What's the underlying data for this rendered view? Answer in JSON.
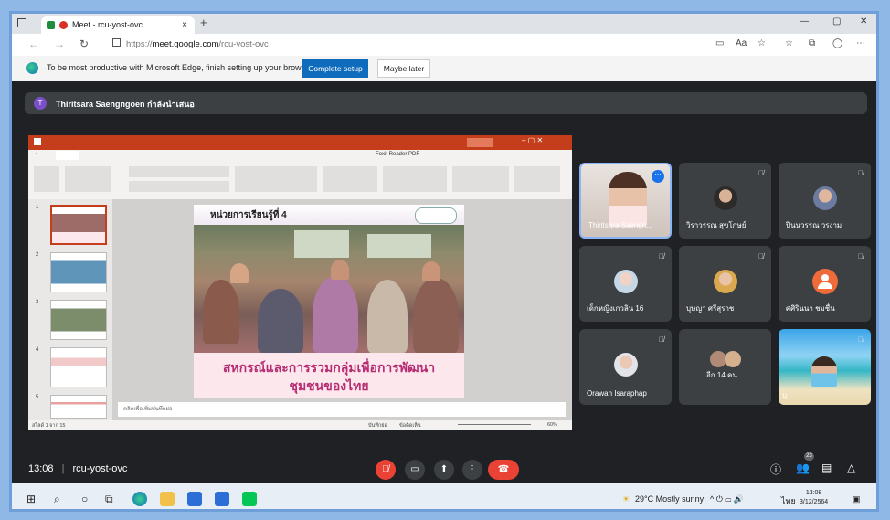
{
  "browser": {
    "tab_title": "Meet - rcu-yost-ovc",
    "tab_close": "×",
    "new_tab": "+",
    "url_prefix": "https://",
    "url_host": "meet.google.com",
    "url_path": "/rcu-yost-ovc",
    "minimize": "—",
    "restore": "▢",
    "close": "✕"
  },
  "infobar": {
    "message": "To be most productive with Microsoft Edge, finish setting up your browser.",
    "primary": "Complete setup",
    "secondary": "Maybe later"
  },
  "presenter_banner": {
    "initial": "T",
    "text": "Thiritsara Saengngoen กำลังนำเสนอ"
  },
  "slide": {
    "heading": "หน่วยการเรียนรู้ที่ 4",
    "caption_line1": "สหกรณ์และการรวมกลุ่มเพื่อการพัฒนา",
    "caption_line2": "ชุมชนของไทย",
    "notes_placeholder": "คลิกเพื่อเพิ่มบันทึกย่อ",
    "status_left": "สไลด์ 1 จาก 15",
    "status_notes": "บันทึกย่อ",
    "status_comments": "ข้อคิดเห็น",
    "zoom": "60%",
    "thumb_numbers": [
      "1",
      "2",
      "3",
      "4",
      "5"
    ]
  },
  "participants": [
    {
      "name": "Thiritsara Saengn...",
      "self": true
    },
    {
      "name": "วิราวรรณ สุขโกษย์"
    },
    {
      "name": "ปิ่นนวรรณ วรงาม"
    },
    {
      "name": "เด็กหญิงเกวลิน 16"
    },
    {
      "name": "บุษญา ศรีสุราช"
    },
    {
      "name": "ศศิรินนา ชมชื่น"
    },
    {
      "name": "Orawan Isaraphap"
    },
    {
      "name": "อีก 14 คน"
    },
    {
      "name": "บุ"
    }
  ],
  "controls": {
    "meeting_time": "13:08",
    "meeting_code": "rcu-yost-ovc",
    "people_count": "23"
  },
  "taskbar": {
    "weather": "29°C  Mostly sunny",
    "lang": "ไทย",
    "time": "13:08",
    "date": "3/12/2564"
  },
  "colors": {
    "meet_bg": "#202124",
    "tile_bg": "#3c4043",
    "end_call": "#ea4335",
    "edge_primary": "#0f6cbd",
    "ppt_red": "#c43e1c",
    "slide_caption": "#b72d73"
  }
}
